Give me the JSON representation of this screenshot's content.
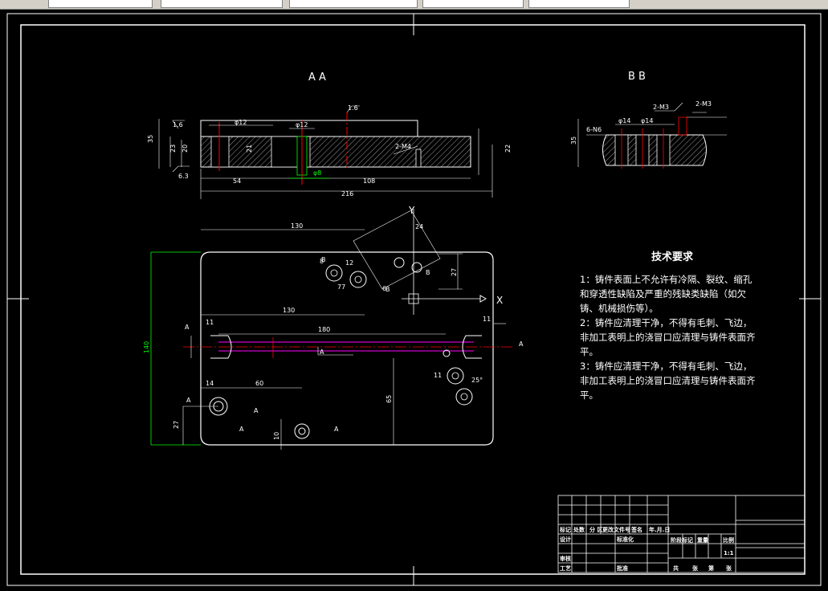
{
  "section_labels": {
    "aa": "A     A",
    "bb": "B     B"
  },
  "tech": {
    "title": "技术要求",
    "lines": [
      "1：铸件表面上不允许有冷隔、裂纹、缩孔",
      "和穿透性缺陷及严重的残缺类缺陷（如欠",
      "铸、机械损伤等）。",
      "2：铸件应清理干净，不得有毛刺、飞边，",
      "非加工表明上的浇冒口应清理与铸件表面齐",
      "平。",
      "3：铸件应清理干净，不得有毛刺、飞边，",
      "非加工表明上的浇冒口应清理与铸件表面齐",
      "平。"
    ]
  },
  "dims": {
    "d35": "35",
    "d23": "23",
    "d20": "20",
    "d21": "21",
    "d22": "22",
    "d54": "54",
    "d108": "108",
    "d216": "216",
    "d130a": "130",
    "d130b": "130",
    "d180": "180",
    "d60": "60",
    "d14": "14",
    "d11a": "11",
    "d11b": "11",
    "d27a": "27",
    "d27b": "27",
    "d65": "65",
    "d140": "140",
    "d10": "10",
    "d63": "6.3",
    "d16a": "1.6",
    "d16b": "1.6",
    "phi12": "φ12",
    "phi12b": "φ12",
    "phi8": "φ8",
    "m4": "2-M4",
    "m3a": "2-M3",
    "m3b": "2-M3",
    "n6": "6-N6",
    "b14a": "φ14",
    "b14b": "φ14",
    "b35": "35",
    "ang25": "25°",
    "d77": "77",
    "d11c": "11",
    "d12c": "12",
    "d8": "8",
    "d6": "6",
    "d24": "24"
  },
  "axes": {
    "x": "X",
    "y": "Y"
  },
  "section_marks": {
    "a": "A",
    "b": "B"
  },
  "title_block": {
    "row1": [
      "标记",
      "处数",
      "分 区",
      "更改文件号",
      "签名",
      "年.月.日"
    ],
    "design": "设计",
    "standard": "标准化",
    "stage": [
      "阶段标记",
      "重量",
      "比例"
    ],
    "scale": "1:1",
    "review": "审核",
    "process": "工艺",
    "approve": "批准",
    "sheets": [
      "共",
      "张",
      "第",
      "张"
    ]
  },
  "colors": {
    "bg": "#000000",
    "line": "#ffffff",
    "dim_green": "#00ff00",
    "center_red": "#ff0000",
    "magenta": "#ff00ff"
  }
}
